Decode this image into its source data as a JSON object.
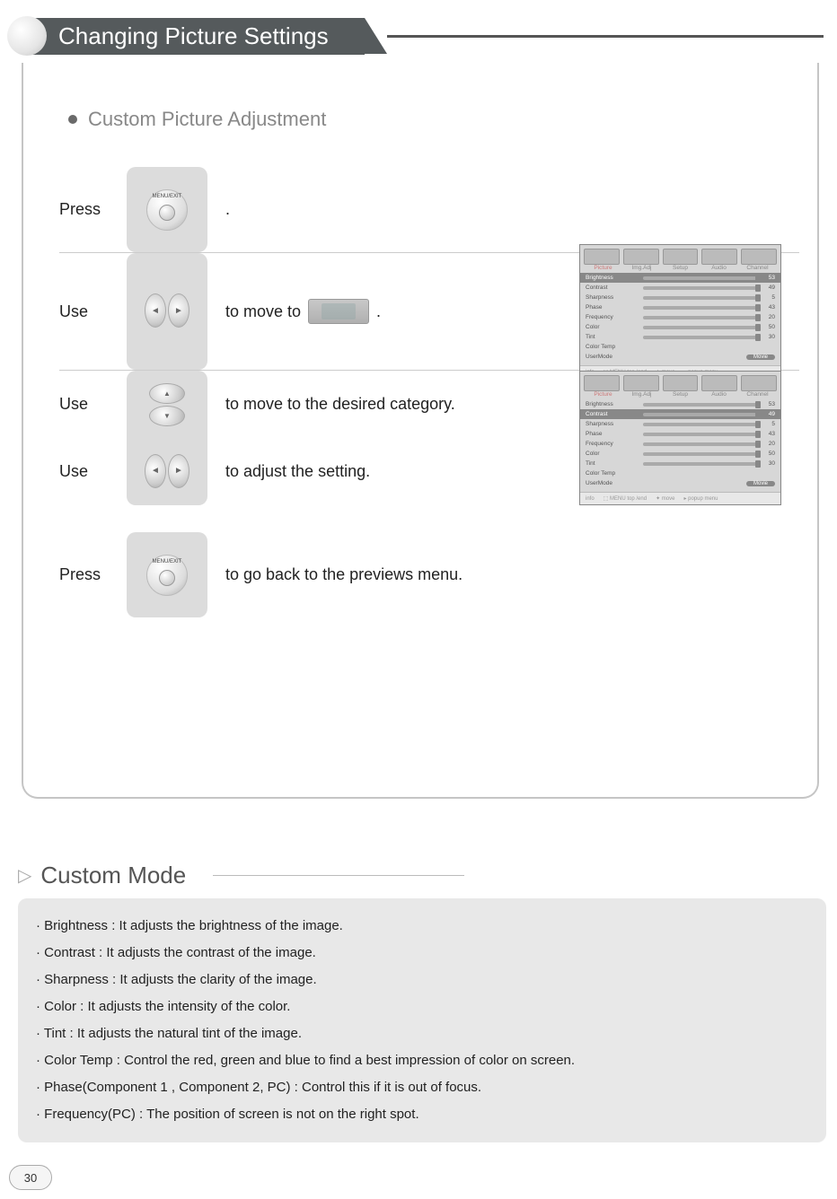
{
  "header": {
    "title": "Changing Picture Settings"
  },
  "section": {
    "heading": "Custom Picture Adjustment"
  },
  "steps": {
    "s1": {
      "verb": "Press",
      "tail": "."
    },
    "s2": {
      "verb": "Use",
      "pre": "to move to",
      "tail": "."
    },
    "s3": {
      "verb": "Use",
      "text": "to  move to the desired category."
    },
    "s4": {
      "verb": "Use",
      "text": "to adjust the setting."
    },
    "s5": {
      "verb": "Press",
      "text": "to go back to the previews menu."
    }
  },
  "menu_label": "MENU/EXIT",
  "osd": {
    "tabs": [
      "Picture",
      "Img.Adj",
      "Setup",
      "Audio",
      "Channel"
    ],
    "rows": [
      {
        "name": "Brightness",
        "val": "53"
      },
      {
        "name": "Contrast",
        "val": "49"
      },
      {
        "name": "Sharpness",
        "val": "5"
      },
      {
        "name": "Phase",
        "val": "43"
      },
      {
        "name": "Frequency",
        "val": "20"
      },
      {
        "name": "Color",
        "val": "50"
      },
      {
        "name": "Tint",
        "val": "30"
      },
      {
        "name": "Color Temp",
        "val": ""
      },
      {
        "name": "UserMode",
        "val": "Movie"
      }
    ],
    "foot": {
      "info": "info",
      "a": "top /end",
      "b": "move",
      "c": "popup menu",
      "btn": "MENU"
    }
  },
  "custom_mode": {
    "title": "Custom Mode",
    "items": [
      "Brightness : It adjusts the brightness of the image.",
      "Contrast : It adjusts the contrast of the image.",
      "Sharpness : It adjusts the clarity of the image.",
      "Color : It adjusts the intensity of the color.",
      "Tint : It adjusts the natural tint of the image.",
      "Color Temp : Control the red, green and blue to find a best impression of color on screen.",
      "Phase(Component 1 , Component 2, PC) : Control this if it is out of focus.",
      "Frequency(PC) : The position of screen is not on the right spot."
    ]
  },
  "page_number": "30"
}
